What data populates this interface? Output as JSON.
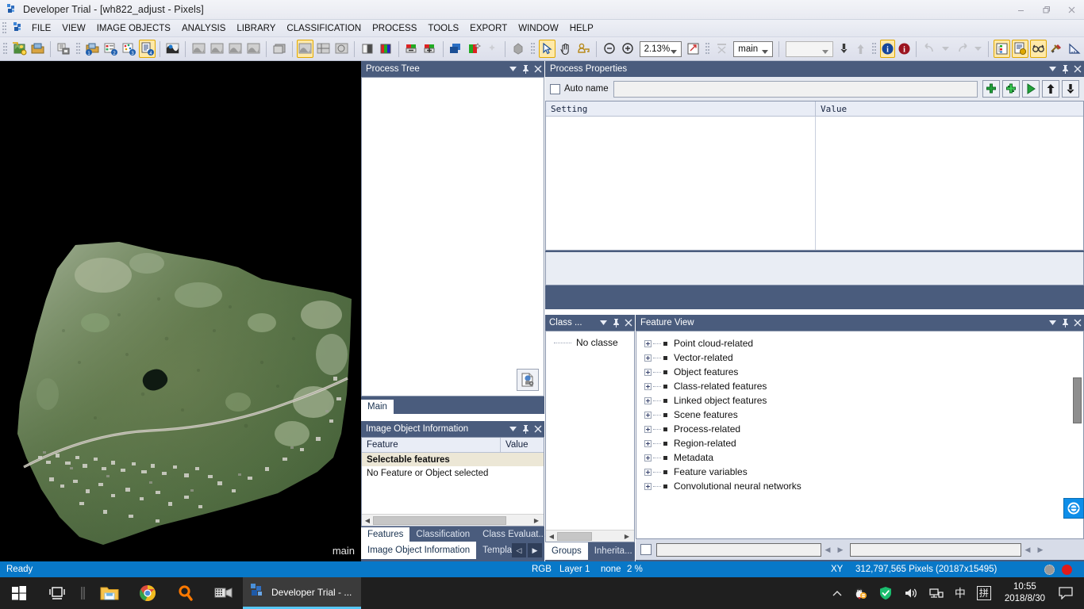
{
  "window": {
    "title": "Developer Trial - [wh822_adjust - Pixels]",
    "minimize": "minimize-icon",
    "restore": "restore-icon",
    "close": "close-icon"
  },
  "menubar": {
    "items": [
      {
        "label": "FILE"
      },
      {
        "label": "VIEW"
      },
      {
        "label": "IMAGE OBJECTS"
      },
      {
        "label": "ANALYSIS"
      },
      {
        "label": "LIBRARY"
      },
      {
        "label": "CLASSIFICATION"
      },
      {
        "label": "PROCESS"
      },
      {
        "label": "TOOLS"
      },
      {
        "label": "EXPORT"
      },
      {
        "label": "WINDOW"
      },
      {
        "label": "HELP"
      }
    ]
  },
  "toolbar": {
    "zoom_value": "2.13%",
    "view_combo_value": "main",
    "second_combo_value": ""
  },
  "canvas": {
    "view_label": "main"
  },
  "process_tree": {
    "title": "Process Tree",
    "tab": "Main"
  },
  "process_properties": {
    "title": "Process Properties",
    "auto_name_label": "Auto name",
    "name_value": "",
    "columns": [
      "Setting",
      "Value"
    ]
  },
  "image_object_information": {
    "title": "Image Object Information",
    "columns": [
      "Feature",
      "Value"
    ],
    "group_row": "Selectable features",
    "empty_row": "No Feature or Object selected",
    "tabs": [
      "Features",
      "Classification",
      "Class Evaluat..."
    ],
    "dock_tabs": [
      "Image Object Information",
      "Templa"
    ]
  },
  "class_hierarchy": {
    "title": "Class ...",
    "tree_root": "No classe",
    "tabs": [
      "Groups",
      "Inherita..."
    ]
  },
  "feature_view": {
    "title": "Feature View",
    "items": [
      "Point cloud-related",
      "Vector-related",
      "Object features",
      "Class-related features",
      "Linked object features",
      "Scene features",
      "Process-related",
      "Region-related",
      "Metadata",
      "Feature variables",
      "Convolutional neural networks"
    ]
  },
  "statusbar": {
    "ready": "Ready",
    "mode": "RGB",
    "layer": "Layer 1",
    "none": "none",
    "percent": "2 %",
    "xy": "XY",
    "pixels": "312,797,565 Pixels  (20187x15495)"
  },
  "taskbar": {
    "start": "start-icon",
    "taskview": "task-view-icon",
    "explorer": "file-explorer-icon",
    "chrome": "chrome-icon",
    "search": "search-icon",
    "app_label": "Developer Trial - ...",
    "tray": {
      "chevron": "show-hidden-icons",
      "qq": "qq-icon",
      "shield": "security-shield-icon",
      "volume": "volume-icon",
      "network": "network-icon",
      "ime_mode": "中",
      "ime_pinyin": "拼",
      "time": "10:55",
      "date": "2018/8/30",
      "notifications": "action-center-icon"
    }
  },
  "colors": {
    "panel_header": "#4a5c7d",
    "status_bar": "#0878c8",
    "accent_yellow": "#ffe9a8",
    "taskbar": "#1f1f1f"
  }
}
